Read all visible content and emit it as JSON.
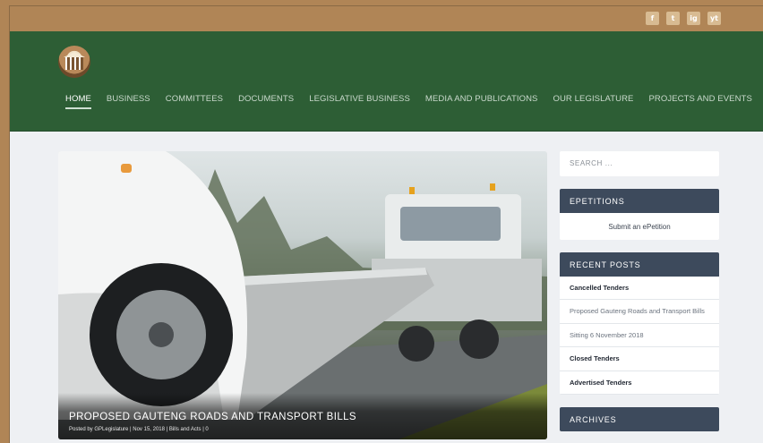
{
  "social": [
    "f",
    "t",
    "ig",
    "yt"
  ],
  "nav": [
    {
      "label": "HOME",
      "active": true
    },
    {
      "label": "BUSINESS"
    },
    {
      "label": "COMMITTEES"
    },
    {
      "label": "DOCUMENTS"
    },
    {
      "label": "LEGISLATIVE BUSINESS"
    },
    {
      "label": "MEDIA AND PUBLICATIONS"
    },
    {
      "label": "OUR LEGISLATURE"
    },
    {
      "label": "PROJECTS AND EVENTS"
    }
  ],
  "hero": {
    "title": "PROPOSED GAUTENG ROADS AND TRANSPORT BILLS",
    "meta": "Posted by GPLegislature | Nov 15, 2018 | Bills and Acts | 0"
  },
  "sidebar": {
    "search_placeholder": "SEARCH ...",
    "epetitions_title": "EPETITIONS",
    "epetitions_link": "Submit an ePetition",
    "recent_title": "RECENT POSTS",
    "recent_posts": [
      "Cancelled Tenders",
      "Proposed Gauteng Roads and Transport Bills",
      "Sitting 6 November 2018",
      "Closed Tenders",
      "Advertised Tenders"
    ],
    "archives_title": "ARCHIVES"
  },
  "colors": {
    "topbar": "#b08556",
    "header": "#2d5e35",
    "widget_title": "#3d4a5c"
  }
}
